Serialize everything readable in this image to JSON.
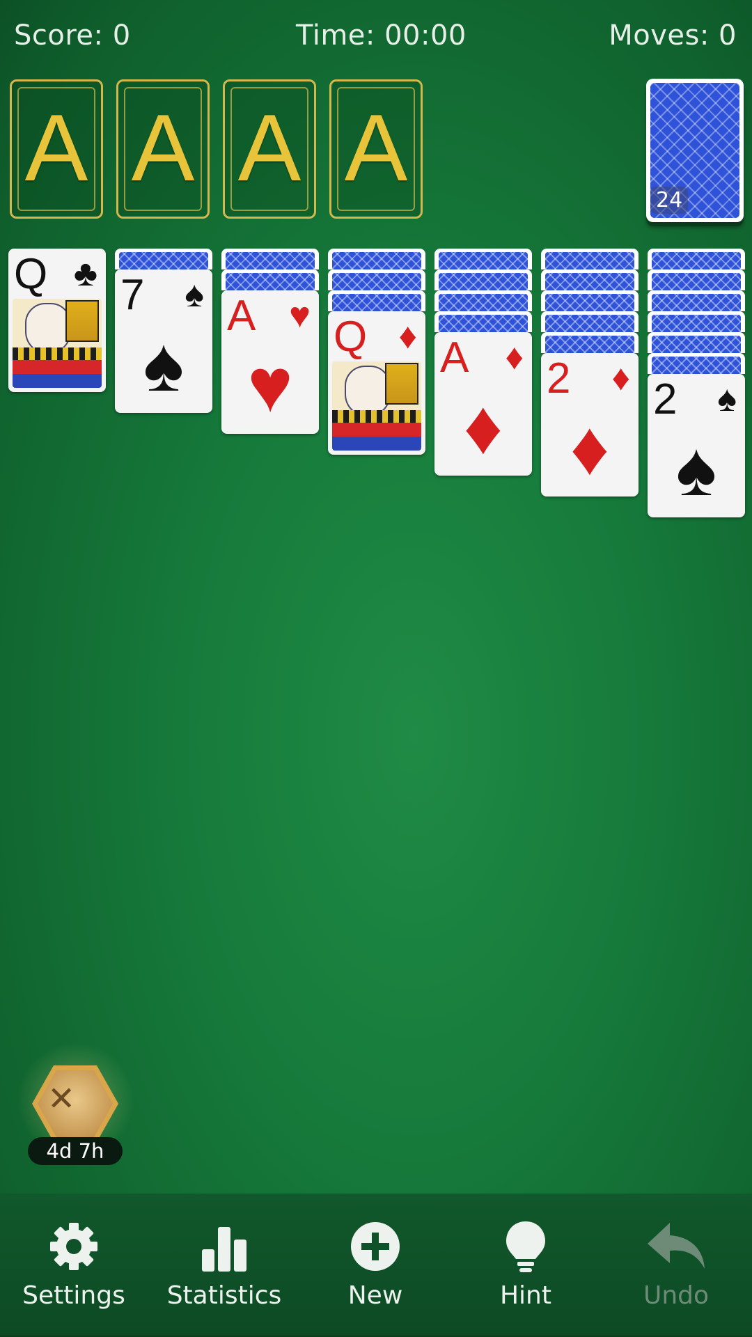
{
  "header": {
    "score": "Score: 0",
    "time": "Time: 00:00",
    "moves": "Moves: 0"
  },
  "foundations": [
    {
      "label": "A"
    },
    {
      "label": "A"
    },
    {
      "label": "A"
    },
    {
      "label": "A"
    }
  ],
  "stock": {
    "count": "24"
  },
  "tableau": [
    {
      "face_down": 0,
      "card": {
        "rank": "Q",
        "suit": "♣",
        "color": "black",
        "face": true
      }
    },
    {
      "face_down": 1,
      "card": {
        "rank": "7",
        "suit": "♠",
        "color": "black"
      }
    },
    {
      "face_down": 2,
      "card": {
        "rank": "A",
        "suit": "♥",
        "color": "red"
      }
    },
    {
      "face_down": 3,
      "card": {
        "rank": "Q",
        "suit": "♦",
        "color": "red",
        "face": true
      }
    },
    {
      "face_down": 4,
      "card": {
        "rank": "A",
        "suit": "♦",
        "color": "red"
      }
    },
    {
      "face_down": 5,
      "card": {
        "rank": "2",
        "suit": "♦",
        "color": "red"
      }
    },
    {
      "face_down": 6,
      "card": {
        "rank": "2",
        "suit": "♠",
        "color": "black"
      }
    }
  ],
  "event_badge": {
    "icon": "treasure-map-icon",
    "timer": "4d 7h"
  },
  "toolbar": {
    "settings": "Settings",
    "statistics": "Statistics",
    "new": "New",
    "hint": "Hint",
    "undo": "Undo"
  },
  "colors": {
    "felt": "#167a3b",
    "card_back": "#2f53d8",
    "gold": "#d4b84c",
    "red_suit": "#d71f1f"
  }
}
